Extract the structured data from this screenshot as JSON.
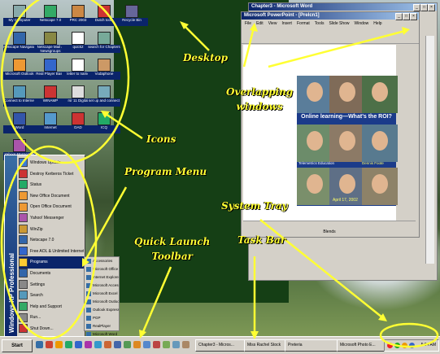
{
  "annotations": {
    "desktop": "Desktop",
    "overlapping": "Overlapping\nwindows",
    "icons": "Icons",
    "program_menu": "Program Menu",
    "system_tray": "System Tray",
    "quick_launch": "Quick Launch\nToolbar",
    "task_bar": "Task Bar"
  },
  "desktop_icons": [
    "My Computer",
    "Netscape 7.0",
    "PRC 2003",
    "Dutch tools",
    "Recycle Bin",
    "Netscape Navigator",
    "Netscape Mail & Newsgroups",
    "quick2",
    "search for Chapters",
    "Microsoft Outlook",
    "Real Player Basic",
    "letter to name",
    "Vodaphone",
    "Connect to Internet",
    "WINAMP",
    "rsr 11 Digital",
    "set up and connect",
    "Word",
    "Internet",
    "DAD",
    "ICQ",
    "Yahoo! Messenger"
  ],
  "word_window": {
    "title": "Chapter3 - Microsoft Word"
  },
  "ppt_window": {
    "title": "Microsoft PowerPoint - [Prelcn1]",
    "menu": [
      "File",
      "Edit",
      "View",
      "Insert",
      "Format",
      "Tools",
      "Slide Show",
      "Window",
      "Help"
    ],
    "slide_title": "Online learning—What’s the ROI?",
    "caption_left": "Telemetrics Education",
    "caption_right": "Dennis Foote",
    "date": "April 17, 2002",
    "status": "Blends"
  },
  "start_menu": {
    "stripe": "Windows XP Professional",
    "items": [
      "Windows Update",
      "Destroy Kerberos Ticket",
      "Status",
      "New Office Document",
      "Open Office Document",
      "Yahoo! Messenger",
      "WinZip",
      "Netscape 7.0",
      "Free AOL & Unlimited Internet",
      "Programs",
      "Documents",
      "Settings",
      "Search",
      "Help and Support",
      "Run...",
      "Shut Down..."
    ],
    "submenu": [
      "Accessories",
      "Microsoft Office",
      "Internet Explorer",
      "Microsoft Access",
      "Microsoft Excel",
      "Microsoft Outlook",
      "Outlook Express",
      "PGP",
      "RealPlayer",
      "Microsoft Word"
    ]
  },
  "taskbar": {
    "start": "Start",
    "buttons": [
      "Chapter3 - Micros...",
      "Miss Rachel Stock",
      "Preteria",
      "Microsoft Photo E..."
    ],
    "clock": "5:34 AM"
  },
  "colors": {
    "annotation": "#ffff33",
    "panel": "#153f15",
    "selection": "#0a246a"
  }
}
